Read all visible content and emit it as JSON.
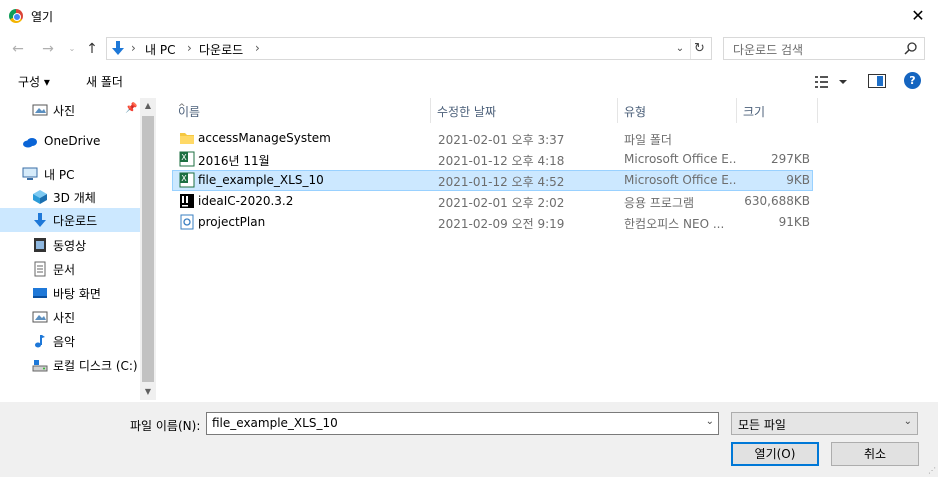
{
  "window": {
    "title": "열기"
  },
  "nav": {
    "breadcrumb": [
      "내 PC",
      "다운로드"
    ],
    "search_placeholder": "다운로드 검색"
  },
  "toolbar": {
    "organize_label": "구성 ▾",
    "new_folder_label": "새 폴더"
  },
  "sidebar": {
    "items": [
      {
        "label": "사진",
        "icon": "pictures-icon"
      },
      {
        "label": "OneDrive",
        "icon": "onedrive-icon"
      },
      {
        "label": "내 PC",
        "icon": "pc-icon"
      },
      {
        "label": "3D 개체",
        "icon": "3d-objects-icon"
      },
      {
        "label": "다운로드",
        "icon": "download-icon",
        "selected": true
      },
      {
        "label": "동영상",
        "icon": "video-icon"
      },
      {
        "label": "문서",
        "icon": "document-icon"
      },
      {
        "label": "바탕 화면",
        "icon": "desktop-icon"
      },
      {
        "label": "사진",
        "icon": "pictures-icon"
      },
      {
        "label": "음악",
        "icon": "music-icon"
      },
      {
        "label": "로컬 디스크 (C:)",
        "icon": "local-disk-icon"
      }
    ]
  },
  "columns": [
    "이름",
    "수정한 날짜",
    "유형",
    "크기"
  ],
  "files": [
    {
      "name": "accessManageSystem",
      "date": "2021-02-01 오후 3:37",
      "type": "파일 폴더",
      "size": "",
      "icon": "folder-icon"
    },
    {
      "name": "2016년 11월",
      "date": "2021-01-12 오후 4:18",
      "type": "Microsoft Office E...",
      "size": "297KB",
      "icon": "excel-icon"
    },
    {
      "name": "file_example_XLS_10",
      "date": "2021-01-12 오후 4:52",
      "type": "Microsoft Office E...",
      "size": "9KB",
      "icon": "excel-icon",
      "selected": true
    },
    {
      "name": "ideaIC-2020.3.2",
      "date": "2021-02-01 오후 2:02",
      "type": "응용 프로그램",
      "size": "630,688KB",
      "icon": "intellij-icon"
    },
    {
      "name": "projectPlan",
      "date": "2021-02-09 오전 9:19",
      "type": "한컴오피스 NEO ...",
      "size": "91KB",
      "icon": "hwp-icon"
    }
  ],
  "footer": {
    "filename_label": "파일 이름(N):",
    "filename_value": "file_example_XLS_10",
    "filetype_value": "모든 파일",
    "open_label": "열기(O)",
    "cancel_label": "취소"
  }
}
